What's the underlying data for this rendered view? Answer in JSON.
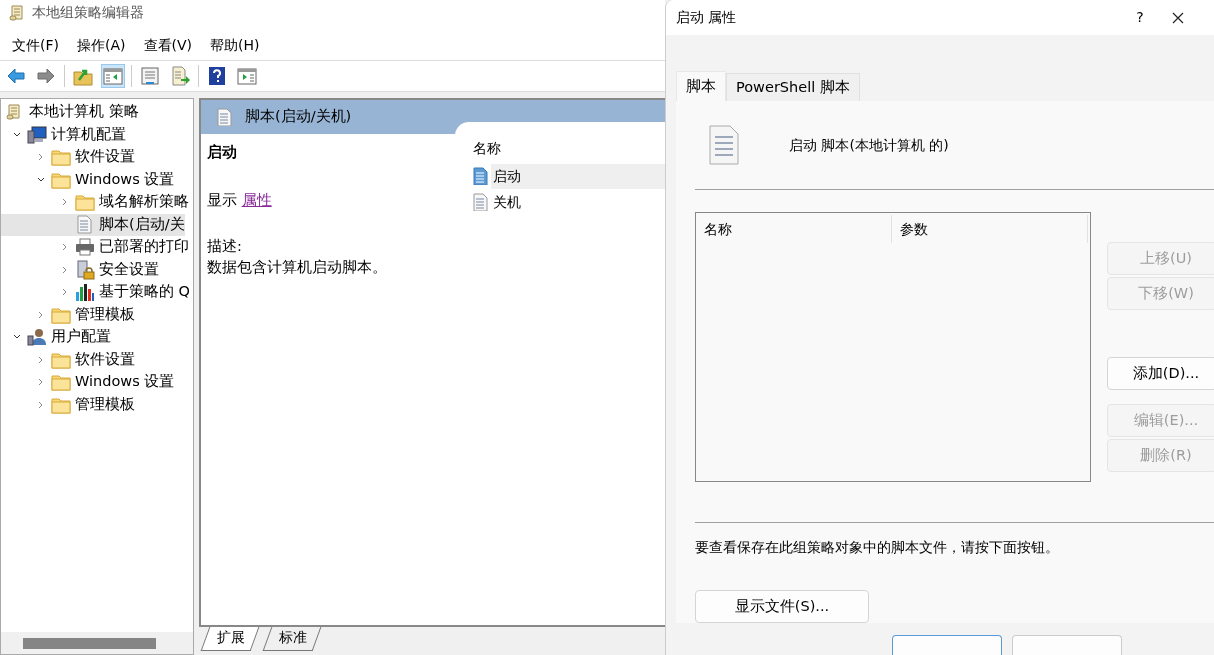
{
  "window": {
    "title": "本地组策略编辑器"
  },
  "menu": [
    "文件(F)",
    "操作(A)",
    "查看(V)",
    "帮助(H)"
  ],
  "toolbar": [
    {
      "kind": "back",
      "disabled": false
    },
    {
      "kind": "forward",
      "disabled": true
    },
    {
      "kind": "sep"
    },
    {
      "kind": "up",
      "disabled": false
    },
    {
      "kind": "pane",
      "disabled": false,
      "selected": true
    },
    {
      "kind": "sep"
    },
    {
      "kind": "list",
      "disabled": false
    },
    {
      "kind": "export",
      "disabled": false
    },
    {
      "kind": "sep"
    },
    {
      "kind": "help",
      "disabled": false
    },
    {
      "kind": "panel",
      "disabled": false
    }
  ],
  "tree": [
    {
      "label": "本地计算机 策略",
      "kind": "policy",
      "selected": false,
      "children": [
        {
          "label": "计算机配置",
          "kind": "computer",
          "expanded": true,
          "selected": false,
          "children": [
            {
              "label": "软件设置",
              "kind": "folder",
              "expanded": false,
              "selected": false
            },
            {
              "label": "Windows 设置",
              "kind": "folder",
              "expanded": true,
              "selected": false,
              "children": [
                {
                  "label": "域名解析策略",
                  "kind": "folder",
                  "expanded": false,
                  "selected": false
                },
                {
                  "label": "脚本(启动/关",
                  "kind": "script",
                  "selected": true
                },
                {
                  "label": "已部署的打印",
                  "kind": "printer",
                  "expanded": false,
                  "selected": false
                },
                {
                  "label": "安全设置",
                  "kind": "security",
                  "expanded": false,
                  "selected": false
                },
                {
                  "label": "基于策略的 Q",
                  "kind": "chart",
                  "expanded": false,
                  "selected": false
                }
              ]
            },
            {
              "label": "管理模板",
              "kind": "folder",
              "expanded": false,
              "selected": false
            }
          ]
        },
        {
          "label": "用户配置",
          "kind": "user",
          "expanded": true,
          "selected": false,
          "children": [
            {
              "label": "软件设置",
              "kind": "folder",
              "expanded": false,
              "selected": false
            },
            {
              "label": "Windows 设置",
              "kind": "folder",
              "expanded": false,
              "selected": false
            },
            {
              "label": "管理模板",
              "kind": "folder",
              "expanded": false,
              "selected": false
            }
          ]
        }
      ]
    }
  ],
  "details": {
    "header": "脚本(启动/关机)",
    "item_title": "启动",
    "show_label": "显示",
    "show_link": "属性",
    "desc_label": "描述:",
    "description": "数据包含计算机启动脚本。",
    "column": "名称",
    "items": [
      {
        "label": "启动",
        "selected": true
      },
      {
        "label": "关机",
        "selected": false
      }
    ]
  },
  "view_tabs": [
    {
      "label": "扩展",
      "selected": true
    },
    {
      "label": "标准",
      "selected": false
    }
  ],
  "dialog": {
    "title": "启动 属性",
    "help": "?",
    "tabs": [
      {
        "label": "脚本",
        "selected": true
      },
      {
        "label": "PowerShell 脚本",
        "selected": false
      }
    ],
    "heading": "启动 脚本(本地计算机 的)",
    "columns": [
      "名称",
      "参数"
    ],
    "buttons": [
      {
        "label": "上移(U)",
        "disabled": true
      },
      {
        "label": "下移(W)",
        "disabled": true
      },
      {
        "label": "添加(D)...",
        "disabled": false
      },
      {
        "label": "编辑(E)...",
        "disabled": true
      },
      {
        "label": "删除(R)",
        "disabled": true
      }
    ],
    "note": "要查看保存在此组策略对象中的脚本文件，请按下面按钮。",
    "show_files": "显示文件(S)...",
    "footer_buttons": [
      {
        "default": true
      },
      {
        "default": false
      }
    ]
  }
}
